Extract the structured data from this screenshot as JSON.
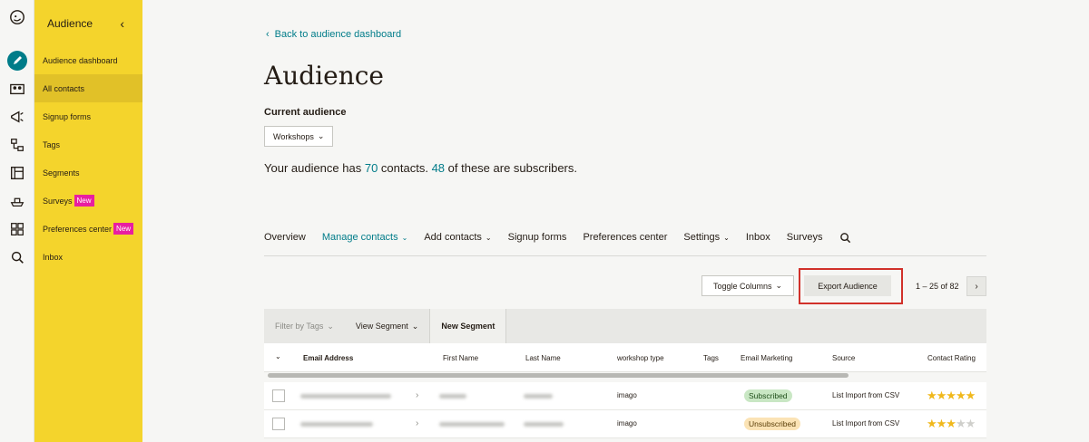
{
  "sidebar": {
    "title": "Audience",
    "items": [
      {
        "label": "Audience dashboard"
      },
      {
        "label": "All contacts"
      },
      {
        "label": "Signup forms"
      },
      {
        "label": "Tags"
      },
      {
        "label": "Segments"
      },
      {
        "label": "Surveys",
        "badge": "New"
      },
      {
        "label": "Preferences center",
        "badge": "New"
      },
      {
        "label": "Inbox"
      }
    ]
  },
  "rail_icons": [
    "mailchimp-logo-icon",
    "pencil-icon",
    "contacts-icon",
    "campaign-megaphone-icon",
    "automations-icon",
    "website-icon",
    "integrations-icon",
    "grid-icon",
    "search-icon"
  ],
  "main": {
    "back_link": "Back to audience dashboard",
    "title": "Audience",
    "current_audience_label": "Current audience",
    "audience_select": "Workshops",
    "summary": {
      "prefix": "Your audience has ",
      "contacts": "70",
      "middle": " contacts. ",
      "subscribers": "48",
      "suffix": " of these are subscribers."
    },
    "tabs": [
      {
        "label": "Overview"
      },
      {
        "label": "Manage contacts",
        "caret": "⌄"
      },
      {
        "label": "Add contacts",
        "caret": "⌄"
      },
      {
        "label": "Signup forms"
      },
      {
        "label": "Preferences center"
      },
      {
        "label": "Settings",
        "caret": "⌄"
      },
      {
        "label": "Inbox"
      },
      {
        "label": "Surveys"
      }
    ],
    "toggle_columns": "Toggle Columns",
    "export_audience": "Export Audience",
    "pagination": "1 – 25 of 82",
    "filter_by_tags": "Filter by Tags",
    "view_segment": "View Segment",
    "new_segment": "New Segment",
    "columns": [
      "Email Address",
      "First Name",
      "Last Name",
      "workshop type",
      "Tags",
      "Email Marketing",
      "Source",
      "Contact Rating"
    ],
    "rows": [
      {
        "workshop_type": "imago",
        "email_marketing": "Subscribed",
        "source": "List Import from CSV",
        "rating": 5
      },
      {
        "workshop_type": "imago",
        "email_marketing": "Unsubscribed",
        "source": "List Import from CSV",
        "rating": 3
      }
    ]
  },
  "colors": {
    "accent": "#007c89",
    "sidebar": "#f4d42c",
    "new_badge": "#e81ea1",
    "highlight": "#d1312a"
  }
}
